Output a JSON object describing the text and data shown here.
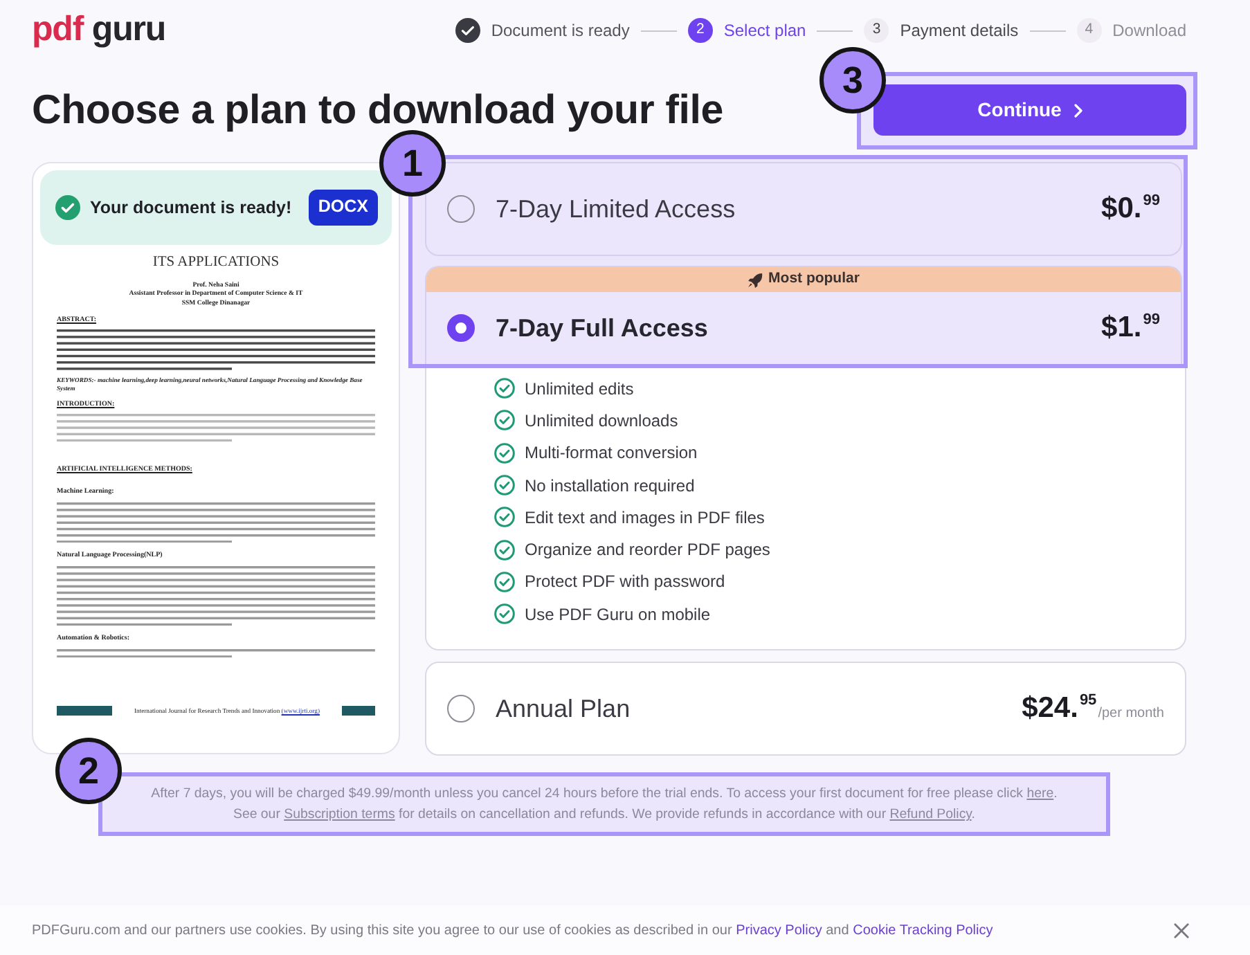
{
  "header": {
    "logo": "pdf guru",
    "steps": [
      {
        "label": "Document is ready",
        "done": true,
        "selected": false,
        "disabled": false
      },
      {
        "number": "2",
        "label": "Select plan",
        "done": false,
        "selected": true,
        "disabled": false
      },
      {
        "number": "3",
        "label": "Payment details",
        "done": false,
        "selected": false,
        "disabled": false
      },
      {
        "number": "4",
        "label": "Download",
        "done": false,
        "selected": false,
        "disabled": true
      }
    ]
  },
  "title": "Choose a plan to download your file",
  "continue_button": {
    "label": "Continue",
    "highlight": {
      "marker": "3"
    }
  },
  "preview": {
    "status_text": "Your document is ready!",
    "format": "DOCX",
    "document": [
      {
        "kind": "title",
        "text": "ITS APPLICATIONS"
      },
      {
        "kind": "byline",
        "text": "Prof. Neha Saini"
      },
      {
        "kind": "byline",
        "text": "Assistant Professor in Department of Computer Science & IT"
      },
      {
        "kind": "byline",
        "text": "SSM College Dinanagar"
      },
      {
        "kind": "heading",
        "text": "ABSTRACT:"
      },
      {
        "kind": "paragraph"
      },
      {
        "kind": "keywords",
        "text": "KEYWORDS:- machine learning,deep learning,neural networks,Natural Language Processing and Knowledge Base System"
      },
      {
        "kind": "heading",
        "text": "INTRODUCTION:"
      },
      {
        "kind": "paragraph"
      },
      {
        "kind": "heading",
        "text": "ARTIFICIAL INTELLIGENCE METHODS:"
      },
      {
        "kind": "subheading",
        "text": "Machine Learning:"
      },
      {
        "kind": "paragraph"
      },
      {
        "kind": "subheading",
        "text": "Natural Language Processing(NLP)"
      },
      {
        "kind": "paragraph"
      },
      {
        "kind": "subheading",
        "text": "Automation & Robotics:"
      },
      {
        "kind": "paragraph"
      },
      {
        "kind": "footer",
        "text": "International Journal for Research Trends and Innovation ",
        "link": "(www.ijrti.org)"
      }
    ]
  },
  "plans": {
    "highlight": {
      "marker": "1"
    },
    "items": [
      {
        "name": "7-Day Limited Access",
        "price": "$0.",
        "cents": "99",
        "selected": false
      },
      {
        "name": "7-Day Full Access",
        "price": "$1.",
        "cents": "99",
        "selected": true,
        "badge": "Most popular",
        "features": [
          "Unlimited edits",
          "Unlimited downloads",
          "Multi-format conversion",
          "No installation required",
          "Edit text and images in PDF files",
          "Organize and reorder PDF pages",
          "Protect PDF with password",
          "Use PDF Guru on mobile"
        ]
      },
      {
        "name": "Annual Plan",
        "price": "$24.",
        "cents": "95",
        "period": "/per month",
        "selected": false
      }
    ]
  },
  "disclaimer": {
    "highlight": {
      "marker": "2"
    },
    "lines": [
      [
        {
          "kind": "text",
          "text": "After 7 days, you will be charged $49.99/month unless you cancel 24 hours before the trial ends. To access your first document for free please click "
        },
        {
          "kind": "link",
          "text": "here"
        },
        {
          "kind": "text",
          "text": "."
        }
      ],
      [
        {
          "kind": "text",
          "text": "See our "
        },
        {
          "kind": "link",
          "text": "Subscription terms"
        },
        {
          "kind": "text",
          "text": " for details on cancellation and refunds. We provide refunds in accordance with our "
        },
        {
          "kind": "link",
          "text": "Refund Policy"
        },
        {
          "kind": "text",
          "text": "."
        }
      ]
    ]
  },
  "cookie_bar": {
    "segments": [
      {
        "kind": "text",
        "text": "PDFGuru.com and our partners use cookies. By using this site you agree to our use of cookies as described in our "
      },
      {
        "kind": "link",
        "text": "Privacy Policy"
      },
      {
        "kind": "text",
        "text": " and "
      },
      {
        "kind": "link",
        "text": "Cookie Tracking Policy"
      }
    ]
  }
}
